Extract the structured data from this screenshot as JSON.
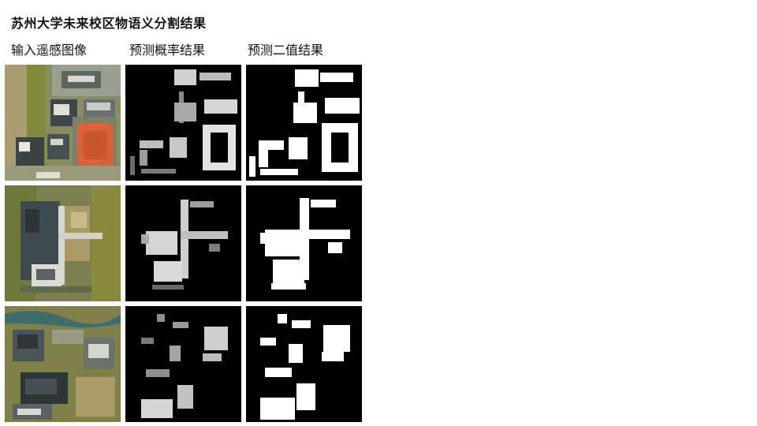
{
  "title": "苏州大学未来校区物语义分割结果",
  "columns": [
    "输入遥感图像",
    "预测概率结果",
    "预测二值结果"
  ],
  "colors": {
    "background": "#ffffff",
    "mask_background": "#000000",
    "mask_foreground": "#ffffff",
    "field_red": "#d9623a",
    "grass": "#7f8a3c",
    "dry_grass": "#a99a66",
    "water": "#3f6d6a"
  }
}
